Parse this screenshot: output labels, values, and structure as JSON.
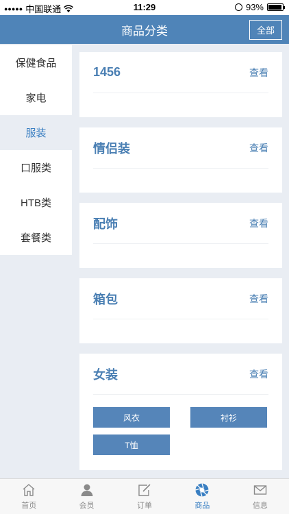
{
  "status_bar": {
    "carrier": "中国联通",
    "time": "11:29",
    "battery": "93%",
    "battery_level": 0.93
  },
  "header": {
    "title": "商品分类",
    "all_button": "全部"
  },
  "sidebar": {
    "items": [
      {
        "label": "保健食品"
      },
      {
        "label": "家电"
      },
      {
        "label": "服装"
      },
      {
        "label": "口服类"
      },
      {
        "label": "HTB类"
      },
      {
        "label": "套餐类"
      }
    ],
    "active_index": 2
  },
  "cards": [
    {
      "title": "1456",
      "link": "查看"
    },
    {
      "title": "情侣装",
      "link": "查看"
    },
    {
      "title": "配饰",
      "link": "查看"
    },
    {
      "title": "箱包",
      "link": "查看"
    },
    {
      "title": "女装",
      "link": "查看",
      "tags": [
        "风衣",
        "衬衫",
        "T恤"
      ]
    }
  ],
  "tabbar": {
    "items": [
      {
        "label": "首页",
        "icon": "home-icon"
      },
      {
        "label": "会员",
        "icon": "user-icon"
      },
      {
        "label": "订单",
        "icon": "order-icon"
      },
      {
        "label": "商品",
        "icon": "shutter-icon"
      },
      {
        "label": "信息",
        "icon": "mail-icon"
      }
    ],
    "active_index": 3
  },
  "colors": {
    "accent": "#4f84b8",
    "tag": "#5585b9",
    "background": "#e9edf3"
  }
}
